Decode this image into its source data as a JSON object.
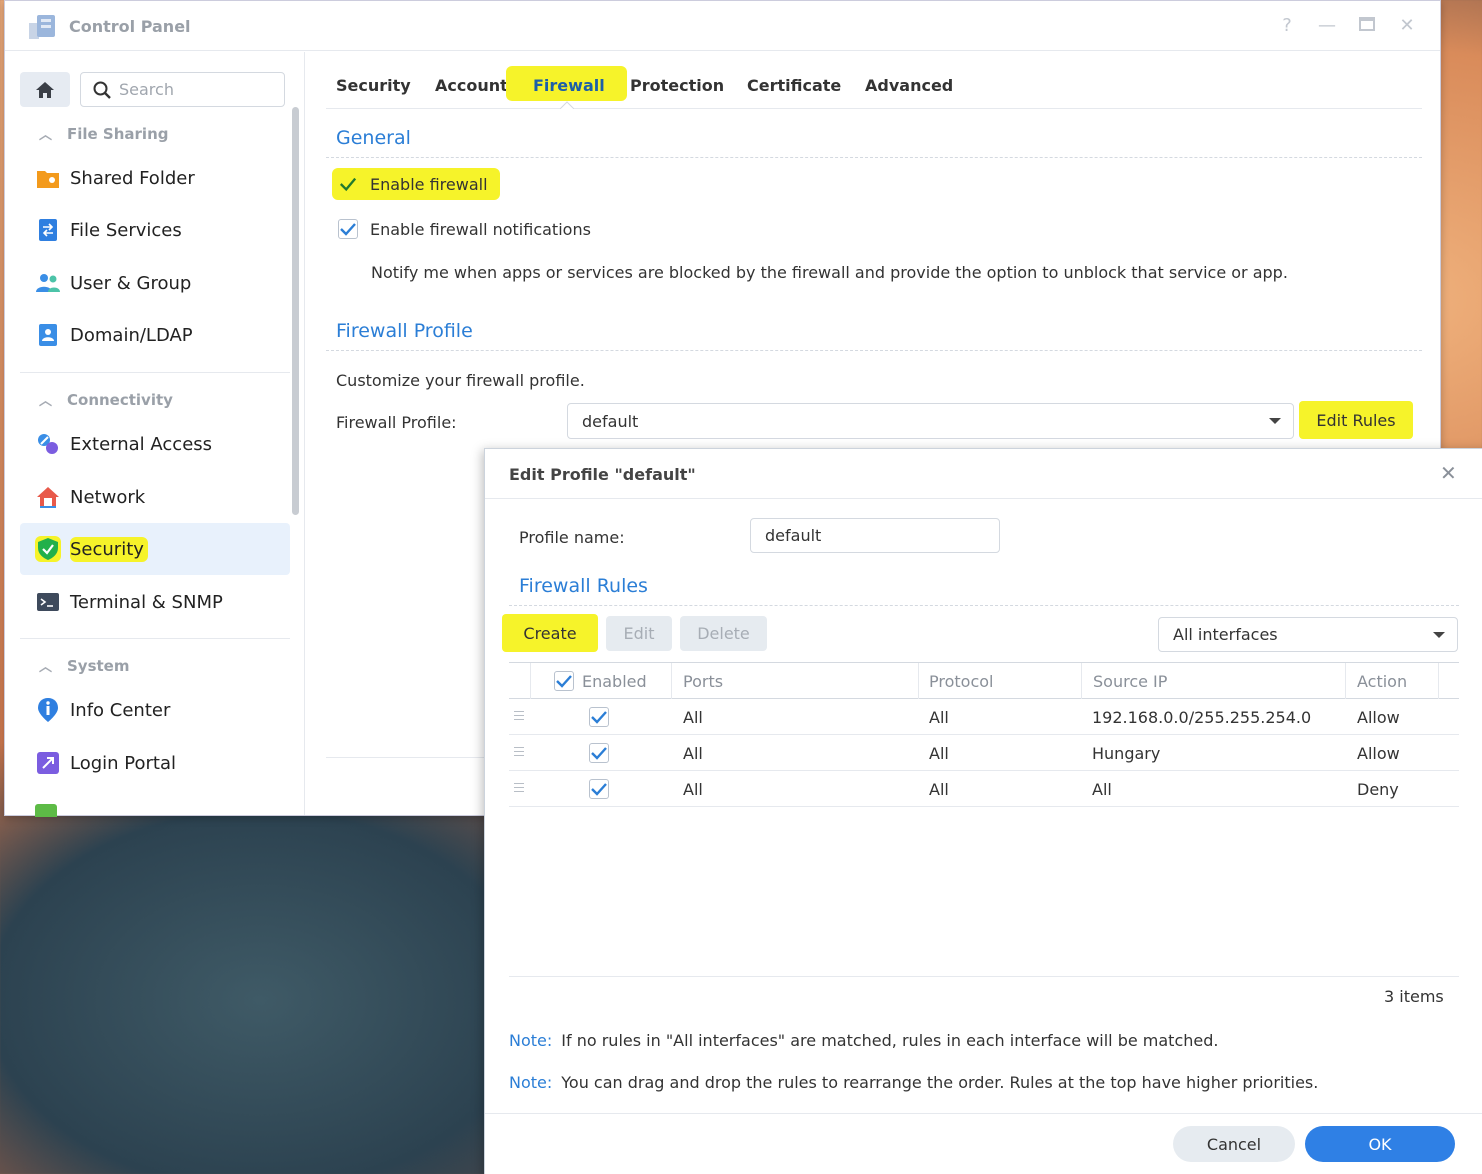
{
  "window": {
    "title": "Control Panel"
  },
  "sidebar": {
    "search_placeholder": "Search",
    "sections": [
      {
        "label": "File Sharing",
        "items": [
          "Shared Folder",
          "File Services",
          "User & Group",
          "Domain/LDAP"
        ]
      },
      {
        "label": "Connectivity",
        "items": [
          "External Access",
          "Network",
          "Security",
          "Terminal & SNMP"
        ]
      },
      {
        "label": "System",
        "items": [
          "Info Center",
          "Login Portal"
        ]
      }
    ],
    "active_item": "Security"
  },
  "tabs": [
    "Security",
    "Account",
    "Firewall",
    "Protection",
    "Certificate",
    "Advanced"
  ],
  "active_tab": "Firewall",
  "general": {
    "heading": "General",
    "enable_firewall": "Enable firewall",
    "enable_notifications": "Enable firewall notifications",
    "notify_desc": "Notify me when apps or services are blocked by the firewall and provide the option to unblock that service or app."
  },
  "profile": {
    "heading": "Firewall Profile",
    "desc": "Customize your firewall profile.",
    "label": "Firewall Profile:",
    "value": "default",
    "edit_button": "Edit Rules"
  },
  "dialog": {
    "title": "Edit Profile \"default\"",
    "profile_name_label": "Profile name:",
    "profile_name_value": "default",
    "rules_heading": "Firewall Rules",
    "buttons": {
      "create": "Create",
      "edit": "Edit",
      "delete": "Delete"
    },
    "interfaces": "All interfaces",
    "columns": [
      "Enabled",
      "Ports",
      "Protocol",
      "Source IP",
      "Action"
    ],
    "rows": [
      {
        "ports": "All",
        "protocol": "All",
        "source_ip": "192.168.0.0/255.255.254.0",
        "action": "Allow"
      },
      {
        "ports": "All",
        "protocol": "All",
        "source_ip": "Hungary",
        "action": "Allow"
      },
      {
        "ports": "All",
        "protocol": "All",
        "source_ip": "All",
        "action": "Deny"
      }
    ],
    "count": "3 items",
    "notes": [
      {
        "label": "Note:",
        "text": "If no rules in \"All interfaces\" are matched, rules in each interface will be matched."
      },
      {
        "label": "Note:",
        "text": "You can drag and drop the rules to rearrange the order. Rules at the top have higher priorities."
      }
    ],
    "cancel": "Cancel",
    "ok": "OK"
  },
  "colors": {
    "accent": "#2b7ed6",
    "highlight": "#f6f32a",
    "primary_button": "#2f80e5"
  }
}
